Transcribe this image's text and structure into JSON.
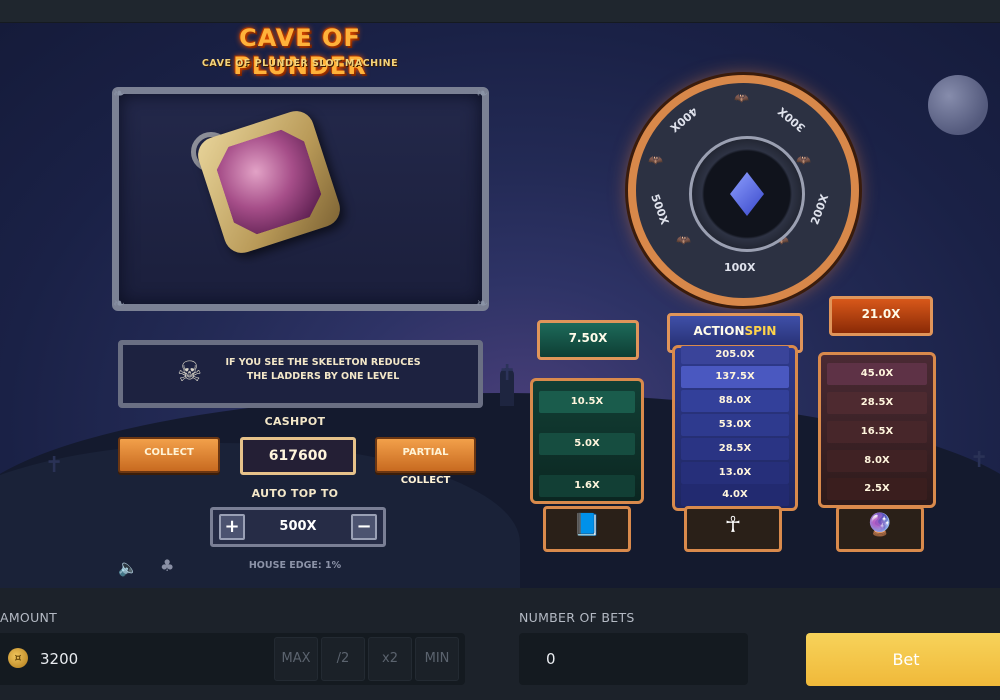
{
  "game": {
    "title": "CAVE OF PLUNDER",
    "subtitle": "CAVE OF PLUNDER SLOT MACHINE",
    "info_text": "IF YOU SEE THE SKELETON REDUCES THE LADDERS BY ONE LEVEL",
    "cashpot_label": "CASHPOT",
    "cashpot_value": "617600",
    "collect_label": "COLLECT",
    "partial_collect_label": "PARTIAL COLLECT",
    "auto_top_label": "AUTO TOP TO",
    "auto_top_value": "500X",
    "house_edge": "HOUSE EDGE: 1%"
  },
  "wheel": {
    "labels": [
      "100X",
      "200X",
      "300X",
      "400X",
      "500X"
    ],
    "center_icon": "diamond-icon"
  },
  "ladders": [
    {
      "name": "green",
      "top": "7.50X",
      "rungs": [
        "10.5X",
        "5.0X",
        "1.6X"
      ],
      "icon": "book-icon",
      "color": "#1f5a4a"
    },
    {
      "name": "blue",
      "top": "ACTIONSPIN",
      "top_highlight": "SPIN",
      "top_prefix": "ACTION",
      "rungs": [
        "205.0X",
        "137.5X",
        "88.0X",
        "53.0X",
        "28.5X",
        "13.0X",
        "4.0X"
      ],
      "icon": "ankh-icon",
      "color": "#2a3a8a"
    },
    {
      "name": "red",
      "top": "21.0X",
      "rungs": [
        "45.0X",
        "28.5X",
        "16.5X",
        "8.0X",
        "2.5X"
      ],
      "icon": "amulet-icon",
      "color": "#5a2a22"
    }
  ],
  "bottom": {
    "amount_label": "AMOUNT",
    "amount_value": "3200",
    "amount_buttons": [
      "MAX",
      "/2",
      "x2",
      "MIN"
    ],
    "bets_label": "NUMBER OF BETS",
    "bets_value": "0",
    "bet_button": "Bet"
  },
  "colors": {
    "accent": "#f0b93a",
    "frame_orange": "#d98a4c"
  }
}
